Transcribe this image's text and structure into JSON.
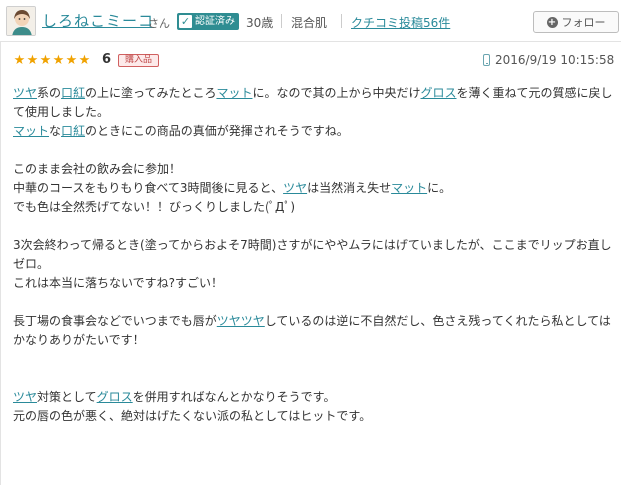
{
  "user": {
    "name": "しろねこミーコ",
    "honorific": "さん",
    "verified_label": "認証済み",
    "age": "30歳",
    "skin_type": "混合肌",
    "posts_label": "クチコミ投稿56件"
  },
  "follow_button": {
    "label": "フォロー"
  },
  "review": {
    "rating": "6",
    "stars_filled": 6,
    "purchase_badge": "購入品",
    "date": "2016/9/19 10:15:58"
  },
  "colors": {
    "accent": "#2a8a9a",
    "star": "#f0a200",
    "badge": "#c04a4a",
    "verified": "#2f8d92"
  },
  "body": {
    "p1": [
      {
        "t": "ツヤ",
        "k": true
      },
      {
        "t": "系の"
      },
      {
        "t": "口紅",
        "k": true
      },
      {
        "t": "の上に塗ってみたところ"
      },
      {
        "t": "マット",
        "k": true
      },
      {
        "t": "に。なので其の上から中央だけ"
      },
      {
        "t": "グロス",
        "k": true
      },
      {
        "t": "を薄く重ねて元の質感に戻して使用しました。"
      }
    ],
    "p2": [
      {
        "t": "マット",
        "k": true
      },
      {
        "t": "な"
      },
      {
        "t": "口紅",
        "k": true
      },
      {
        "t": "のときにこの商品の真価が発揮されそうですね。"
      }
    ],
    "p3": [
      {
        "t": "このまま会社の飲み会に参加！"
      }
    ],
    "p4": [
      {
        "t": "中華のコースをもりもり食べて3時間後に見ると、"
      },
      {
        "t": "ツヤ",
        "k": true
      },
      {
        "t": "は当然消え失せ"
      },
      {
        "t": "マット",
        "k": true
      },
      {
        "t": "に。"
      }
    ],
    "p5": [
      {
        "t": "でも色は全然禿げてない！！びっくりしました(ﾟДﾟ)"
      }
    ],
    "p6": [
      {
        "t": "3次会終わって帰るとき(塗ってからおよそ7時間)さすがにややムラにはげていましたが、ここまでリップお直しゼロ。"
      }
    ],
    "p7": [
      {
        "t": "これは本当に落ちないですね?すごい！"
      }
    ],
    "p8": [
      {
        "t": "長丁場の食事会などでいつまでも唇が"
      },
      {
        "t": "ツヤツヤ",
        "k": true
      },
      {
        "t": "しているのは逆に不自然だし、色さえ残ってくれたら私としてはかなりありがたいです！"
      }
    ],
    "p9": [
      {
        "t": "ツヤ",
        "k": true
      },
      {
        "t": "対策として"
      },
      {
        "t": "グロス",
        "k": true
      },
      {
        "t": "を併用すればなんとかなりそうです。"
      }
    ],
    "p10": [
      {
        "t": "元の唇の色が悪く、絶対はげたくない派の私としてはヒットです。"
      }
    ]
  }
}
